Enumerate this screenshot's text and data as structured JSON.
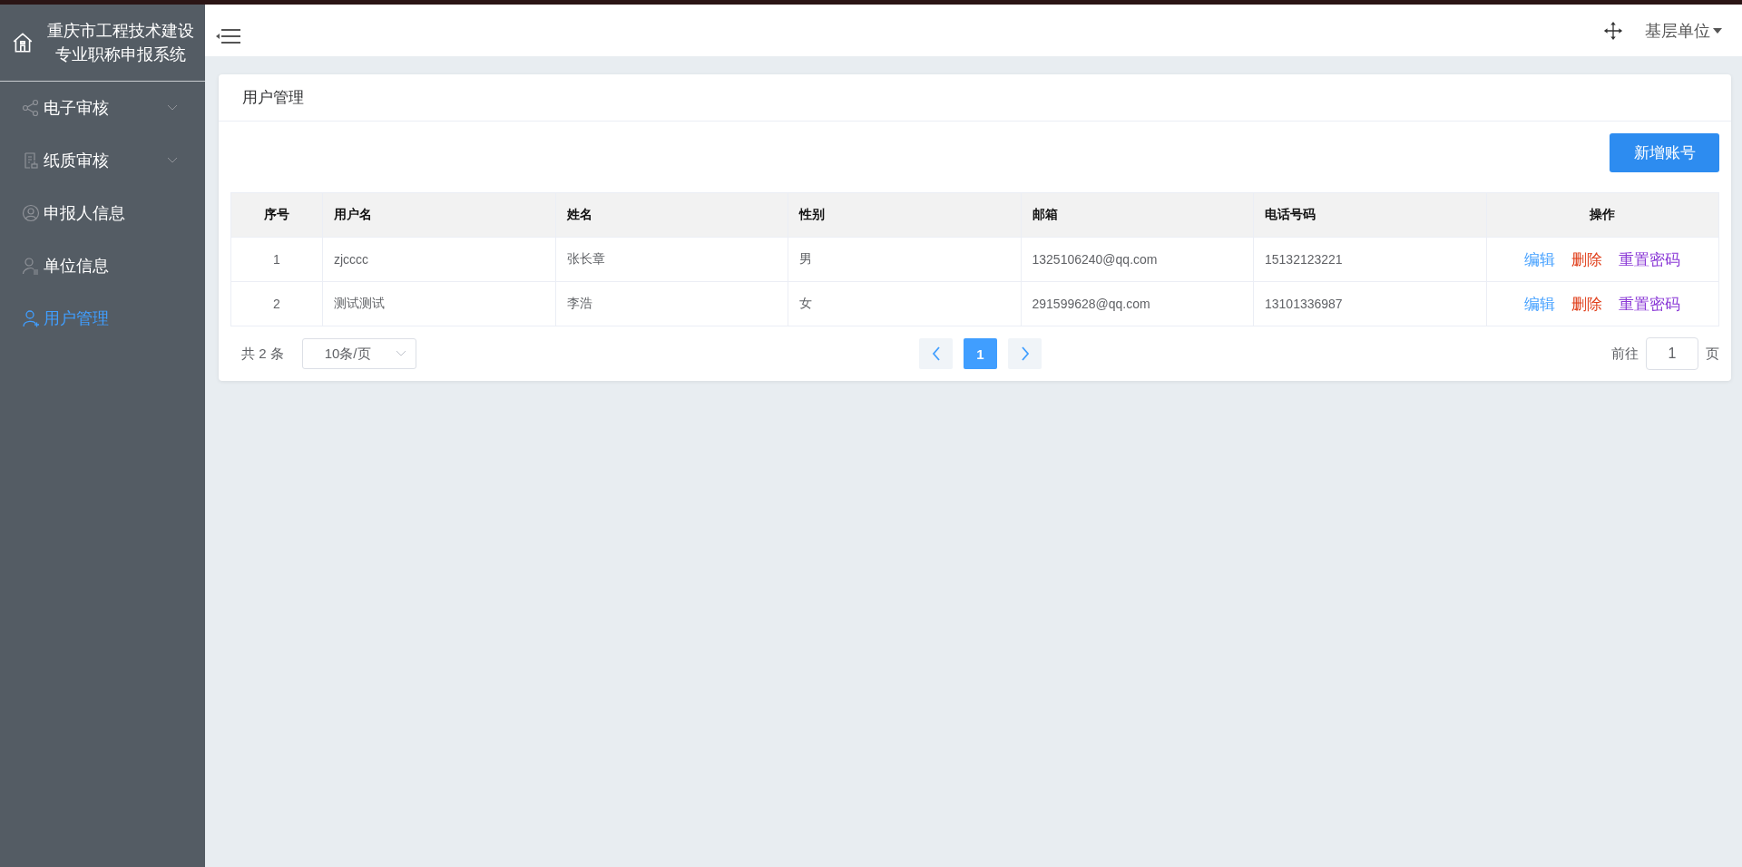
{
  "sidebar": {
    "title_lines": [
      "重庆市工程技术建设",
      "专业职称申报系统"
    ],
    "items": [
      {
        "label": "电子审核",
        "selected": false,
        "expandable": true
      },
      {
        "label": "纸质审核",
        "selected": false,
        "expandable": true
      },
      {
        "label": "申报人信息",
        "selected": false,
        "expandable": false
      },
      {
        "label": "单位信息",
        "selected": false,
        "expandable": false
      },
      {
        "label": "用户管理",
        "selected": true,
        "expandable": false
      }
    ]
  },
  "header": {
    "user": "基层单位"
  },
  "page": {
    "title": "用户管理",
    "add_button": "新增账号"
  },
  "table": {
    "columns": [
      "序号",
      "用户名",
      "姓名",
      "性别",
      "邮箱",
      "电话号码",
      "操作"
    ],
    "rows": [
      {
        "cells": [
          "1",
          "zjcccc",
          "张长章",
          "男",
          "1325106240@qq.com",
          "15132123221"
        ],
        "actions": [
          {
            "label": "编辑",
            "color": "#409eff"
          },
          {
            "label": "删除",
            "color": "#e0401c"
          },
          {
            "label": "重置密码",
            "color": "#8a38d6"
          }
        ]
      },
      {
        "cells": [
          "2",
          "测试测试",
          "李浩",
          "女",
          "291599628@qq.com",
          "13101336987"
        ],
        "actions": [
          {
            "label": "编辑",
            "color": "#409eff"
          },
          {
            "label": "删除",
            "color": "#e0401c"
          },
          {
            "label": "重置密码",
            "color": "#8a38d6"
          }
        ]
      }
    ]
  },
  "pagination": {
    "total": "共 2 条",
    "page_size": "10条/页",
    "pages": [
      {
        "label": "1",
        "selected": true
      }
    ],
    "goto_label": "前往",
    "goto_value": "1",
    "page_unit": "页"
  }
}
